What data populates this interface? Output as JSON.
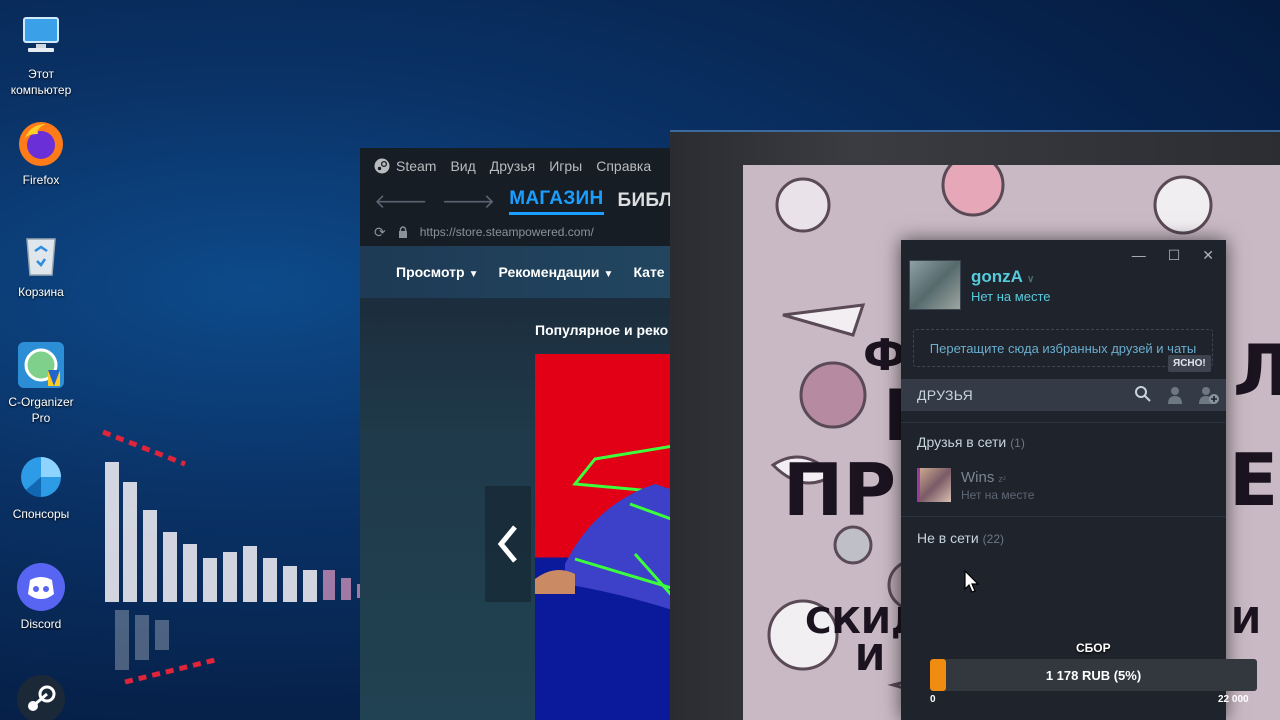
{
  "desktop": {
    "icons": [
      {
        "label": "Этот\nкомпьютер",
        "icon": "computer-icon"
      },
      {
        "label": "Firefox",
        "icon": "firefox-icon"
      },
      {
        "label": "Корзина",
        "icon": "recycle-bin-icon"
      },
      {
        "label": "C-Organizer\nPro",
        "icon": "c-organizer-icon"
      },
      {
        "label": "Спонсоры",
        "icon": "sponsors-icon"
      },
      {
        "label": "Discord",
        "icon": "discord-icon"
      },
      {
        "label": "",
        "icon": "steam-icon"
      }
    ]
  },
  "steam": {
    "menu": [
      "Steam",
      "Вид",
      "Друзья",
      "Игры",
      "Справка"
    ],
    "tabs": [
      "МАГАЗИН",
      "БИБЛИОТЕК"
    ],
    "url": "https://store.steampowered.com/",
    "store_menu": [
      "Просмотр",
      "Рекомендации",
      "Кате"
    ],
    "heading": "Популярное и реко"
  },
  "friends": {
    "username": "gonzA",
    "status": "Нет на месте",
    "drop_hint": "Перетащите сюда избранных друзей и чаты",
    "ok_button": "ЯСНО!",
    "search_label": "ДРУЗЬЯ",
    "online_group": {
      "label": "Друзья в сети",
      "count": "(1)"
    },
    "friend": {
      "name": "Wins",
      "zz": "zᶻ",
      "status": "Нет на месте"
    },
    "offline_group": {
      "label": "Не в сети",
      "count": "(22)"
    }
  },
  "collect": {
    "title": "СБОР",
    "label": "1 178 RUB (5%)",
    "min": "0",
    "max": "22 000",
    "progress_percent": 5
  },
  "colors": {
    "steam_blue": "#1a9fff",
    "friend_accent": "#57cbde",
    "progress": "#f08c10"
  }
}
